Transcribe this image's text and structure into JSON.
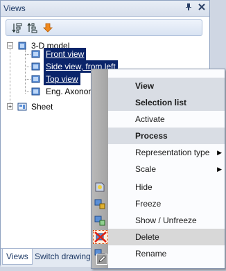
{
  "panel": {
    "title": "Views",
    "pin_icon": "pin-icon",
    "close_icon": "close-icon"
  },
  "toolbar": {
    "buttons": [
      "sort-asc-icon",
      "sort-desc-icon",
      "move-down-icon"
    ]
  },
  "tree": {
    "root": "3-D model",
    "children": [
      "Front view",
      "Side view, from left",
      "Top view",
      "Eng. Axonom"
    ],
    "sheet": "Sheet"
  },
  "tabs": {
    "views": "Views",
    "switch_drawing": "Switch drawing"
  },
  "menu": {
    "items": [
      {
        "label": "View",
        "type": "header"
      },
      {
        "label": "Selection list",
        "type": "header"
      },
      {
        "label": "Activate",
        "type": "item"
      },
      {
        "label": "Process",
        "type": "header"
      },
      {
        "label": "Representation type",
        "type": "submenu"
      },
      {
        "label": "Scale",
        "type": "submenu"
      },
      {
        "label": "Hide",
        "type": "item"
      },
      {
        "label": "Freeze",
        "type": "item"
      },
      {
        "label": "Show / Unfreeze",
        "type": "item"
      },
      {
        "label": "Delete",
        "type": "item"
      },
      {
        "label": "Rename",
        "type": "item"
      }
    ]
  }
}
